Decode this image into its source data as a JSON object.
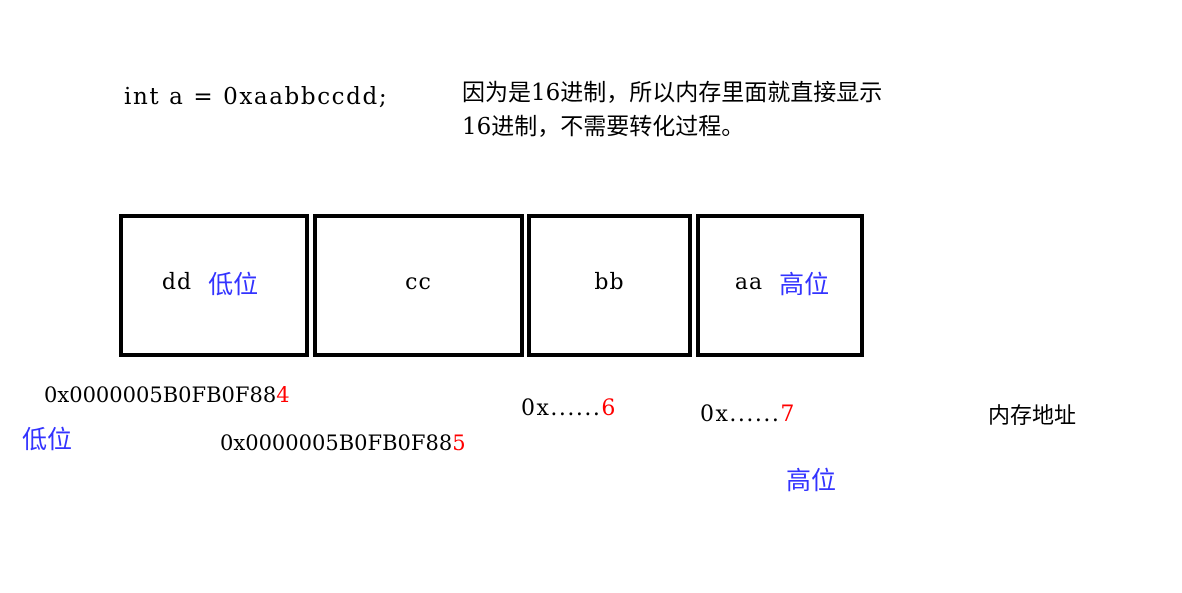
{
  "code": {
    "declaration": "int a = 0xaabbccdd;"
  },
  "note": {
    "line1": "因为是16进制，所以内存里面就直接显示",
    "line2": "16进制，不需要转化过程。"
  },
  "memory": {
    "cells": [
      {
        "value": "dd",
        "tag": "低位"
      },
      {
        "value": "cc",
        "tag": ""
      },
      {
        "value": "bb",
        "tag": ""
      },
      {
        "value": "aa",
        "tag": "高位"
      }
    ]
  },
  "addresses": [
    {
      "prefix": "0x0000005B0FB0F88",
      "tail": "4"
    },
    {
      "prefix": "0x0000005B0FB0F88",
      "tail": "5"
    },
    {
      "prefix": "0x......",
      "tail": "6"
    },
    {
      "prefix": "0x......",
      "tail": "7"
    }
  ],
  "markers": {
    "low": "低位",
    "high": "高位",
    "caption": "内存地址"
  },
  "colors": {
    "endian_blue": "#3333ff",
    "address_tail_red": "#ff0000",
    "border_black": "#000000",
    "background": "#ffffff"
  }
}
